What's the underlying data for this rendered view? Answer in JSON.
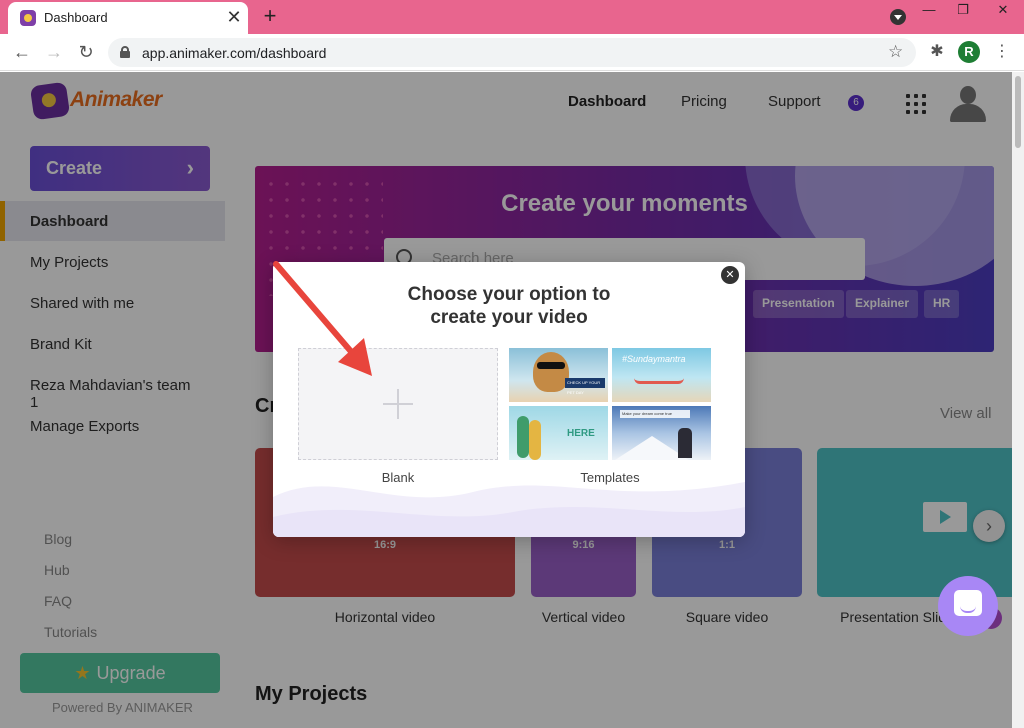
{
  "browser": {
    "tab_title": "Dashboard",
    "tab_close": "✕",
    "new_tab": "+",
    "url": "app.animaker.com/dashboard",
    "back": "←",
    "forward": "→",
    "reload": "↻",
    "star": "☆",
    "extensions": "✱",
    "profile_initial": "R",
    "menu": "⋮",
    "win_min": "—",
    "win_max": "❐",
    "win_close": "✕"
  },
  "app": {
    "logo_text": "Animaker",
    "nav": {
      "dashboard": "Dashboard",
      "pricing": "Pricing",
      "support": "Support",
      "notifications": "6"
    },
    "sidebar": {
      "create": "Create",
      "create_chevron": "›",
      "items": [
        {
          "label": "Dashboard",
          "active": true
        },
        {
          "label": "My Projects"
        },
        {
          "label": "Shared with me"
        },
        {
          "label": "Brand Kit"
        },
        {
          "label": "Reza Mahdavian's team 1"
        },
        {
          "label": "Manage Exports"
        }
      ],
      "links": [
        "Blog",
        "Hub",
        "FAQ",
        "Tutorials"
      ],
      "upgrade": "Upgrade",
      "upgrade_star": "★",
      "powered_by": "Powered By ANIMAKER"
    },
    "hero": {
      "title": "Create your moments",
      "search_placeholder": "Search here",
      "chips": [
        "Presentation",
        "Explainer",
        "HR"
      ]
    },
    "create_section": {
      "title": "Cr",
      "view_all": "View all",
      "cards": [
        {
          "caption": "Horizontal video",
          "ratio": "16:9",
          "color": "#c54b4b"
        },
        {
          "caption": "Vertical video",
          "ratio": "9:16",
          "color": "#9a5fc9"
        },
        {
          "caption": "Square video",
          "ratio": "1:1",
          "color": "#7b7fd9"
        },
        {
          "caption": "Presentation Slide",
          "ratio": "",
          "color": "#4fc3c7"
        }
      ],
      "next": "›",
      "pro_badge": "P"
    },
    "my_projects": "My Projects"
  },
  "modal": {
    "title_line1": "Choose your option to",
    "title_line2": "create your video",
    "close": "✕",
    "blank_label": "Blank",
    "templates_label": "Templates",
    "template_texts": {
      "t1": "CHECK UP YOUR PET DAY",
      "t2": "#Sundaymantra",
      "t3": "HERE",
      "t4": "Make your dream come true"
    }
  },
  "colors": {
    "tab_bar": "#e8658e",
    "accent": "#6b4fd8",
    "upgrade": "#55c9a0",
    "arrow": "#e8453c"
  }
}
